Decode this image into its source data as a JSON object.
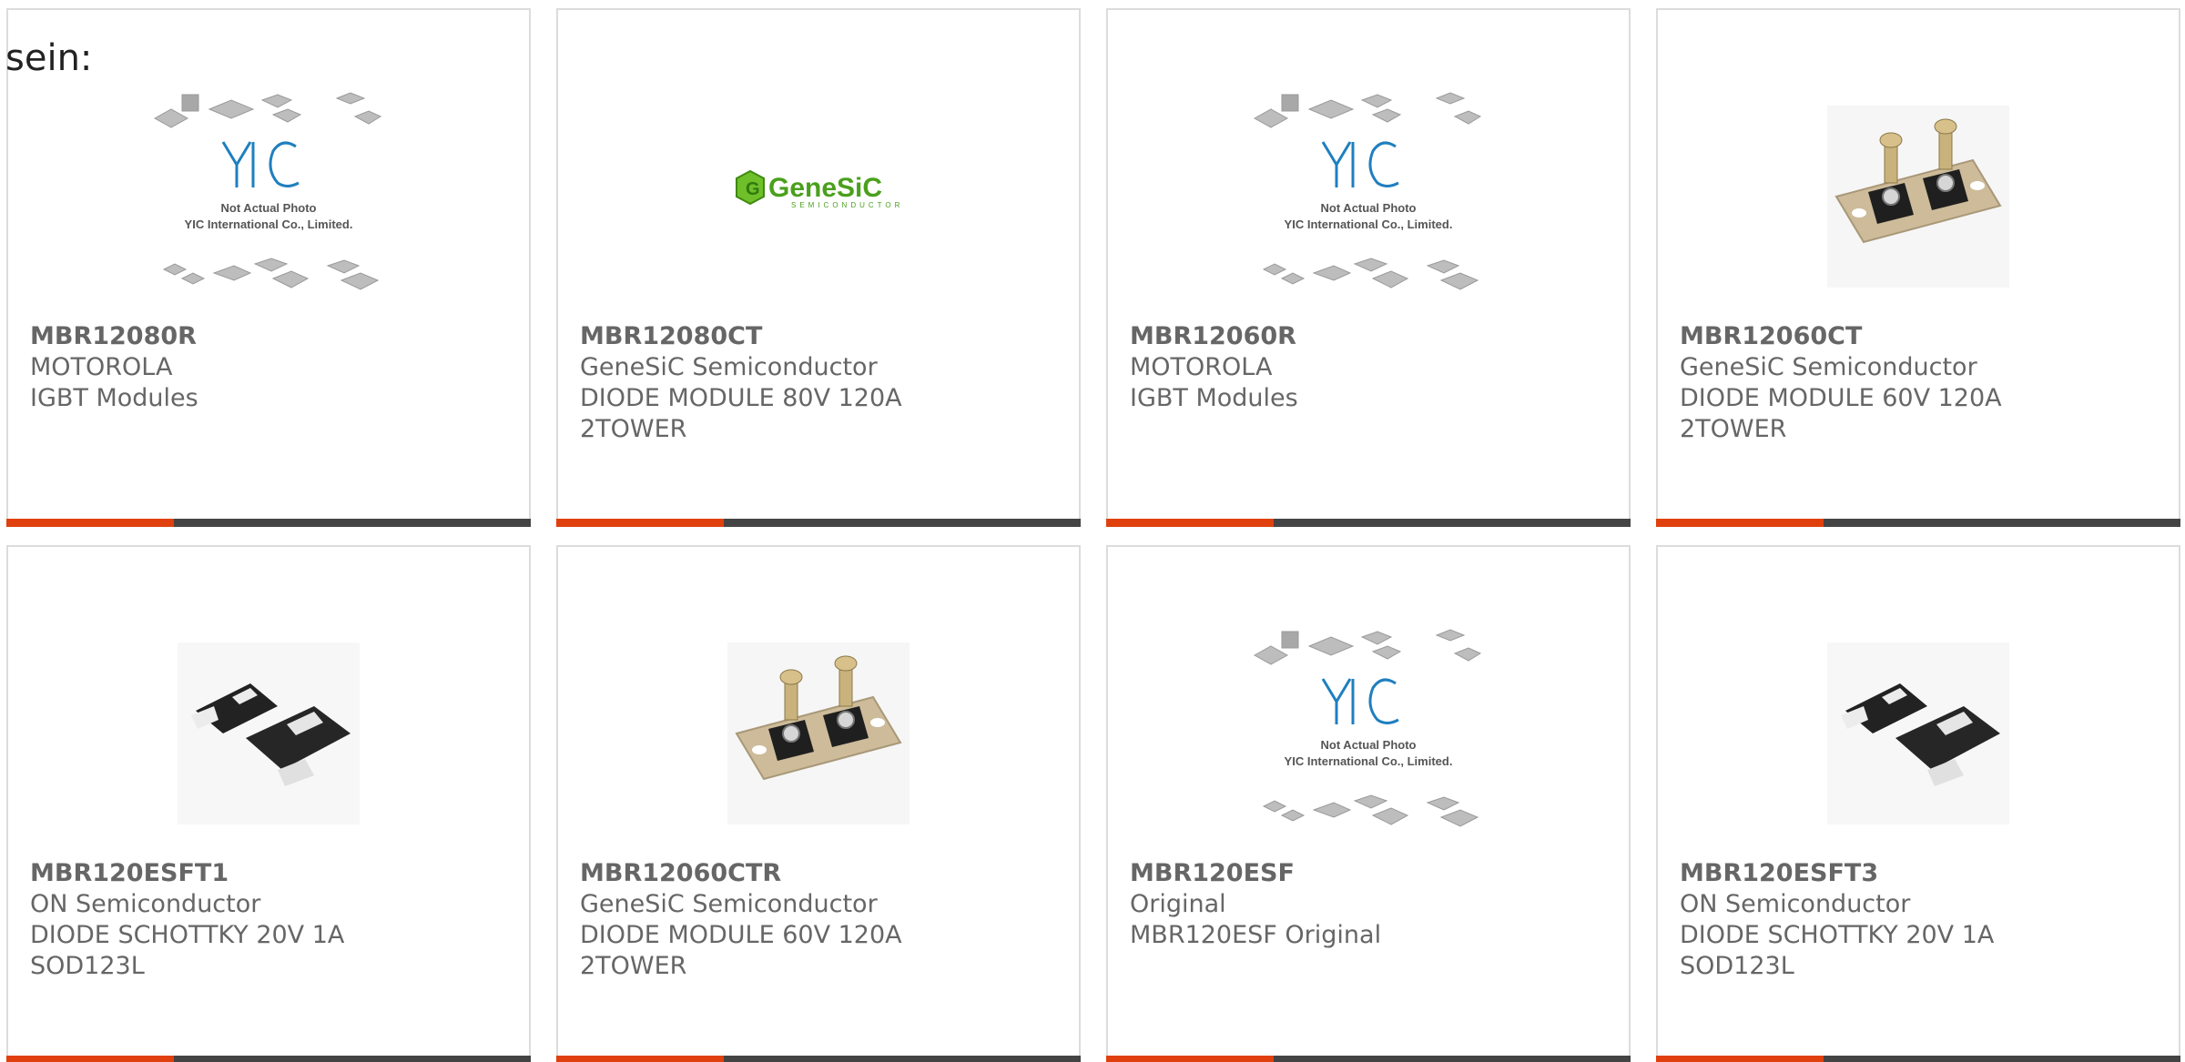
{
  "intro_text": "sein:",
  "products": [
    {
      "part_number": "MBR12080R",
      "manufacturer": "MOTOROLA",
      "description": "IGBT Modules",
      "image": "yic-placeholder",
      "placeholder_line1": "Not Actual Photo",
      "placeholder_line2": "YIC International Co., Limited."
    },
    {
      "part_number": "MBR12080CT",
      "manufacturer": "GeneSiC Semiconductor",
      "description": "DIODE MODULE 80V 120A 2TOWER",
      "image": "genesic-logo",
      "logo_text": "GeneSiC",
      "logo_sub": "SEMICONDUCTOR"
    },
    {
      "part_number": "MBR12060R",
      "manufacturer": "MOTOROLA",
      "description": "IGBT Modules",
      "image": "yic-placeholder",
      "placeholder_line1": "Not Actual Photo",
      "placeholder_line2": "YIC International Co., Limited."
    },
    {
      "part_number": "MBR12060CT",
      "manufacturer": "GeneSiC Semiconductor",
      "description": "DIODE MODULE 60V 120A 2TOWER",
      "image": "diode-module-photo"
    },
    {
      "part_number": "MBR120ESFT1",
      "manufacturer": "ON Semiconductor",
      "description": "DIODE SCHOTTKY 20V 1A SOD123L",
      "image": "sod123-photo"
    },
    {
      "part_number": "MBR12060CTR",
      "manufacturer": "GeneSiC Semiconductor",
      "description": "DIODE MODULE 60V 120A 2TOWER",
      "image": "diode-module-photo"
    },
    {
      "part_number": "MBR120ESF",
      "manufacturer": "Original",
      "description": "MBR120ESF Original",
      "image": "yic-placeholder",
      "placeholder_line1": "Not Actual Photo",
      "placeholder_line2": "YIC International Co., Limited."
    },
    {
      "part_number": "MBR120ESFT3",
      "manufacturer": "ON Semiconductor",
      "description": "DIODE SCHOTTKY 20V 1A SOD123L",
      "image": "sod123-photo"
    }
  ],
  "colors": {
    "accent": "#e0400d",
    "bar": "#444444",
    "text": "#666666",
    "border": "#dcdcdc"
  }
}
